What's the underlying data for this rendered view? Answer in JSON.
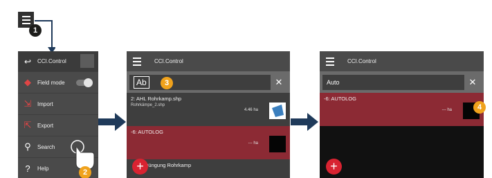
{
  "steps": {
    "s1": "1",
    "s2": "2",
    "s3": "3",
    "s4": "4"
  },
  "menu": {
    "header": "CCI.Control",
    "items": [
      {
        "label": "Field mode",
        "icon": "field-mode-icon"
      },
      {
        "label": "Import",
        "icon": "import-icon"
      },
      {
        "label": "Export",
        "icon": "export-icon"
      },
      {
        "label": "Search",
        "icon": "search-icon"
      },
      {
        "label": "Help",
        "icon": "help-icon"
      }
    ]
  },
  "panel2": {
    "title": "CCI.Control",
    "search_value": "Ab",
    "entries": [
      {
        "name": "2: AHL Rohrkamp.shp",
        "sub": "Rohrkämpe_2.shp",
        "ha": "4.46 ha"
      },
      {
        "name": "-6: AUTOLOG",
        "sub": "",
        "ha": "--- ha"
      },
      {
        "name": "Düngung Rohrkamp",
        "sub": "",
        "ha": ""
      }
    ],
    "fab": "+"
  },
  "panel3": {
    "title": "CCI.Control",
    "search_value": "Auto",
    "entries": [
      {
        "name": "-6: AUTOLOG",
        "sub": "",
        "ha": "--- ha"
      }
    ],
    "fab": "+"
  },
  "colors": {
    "accent_red": "#d82331",
    "row_red": "#8c2a34",
    "arrow_blue": "#1f3a5a",
    "badge_orange": "#f0a21c"
  }
}
